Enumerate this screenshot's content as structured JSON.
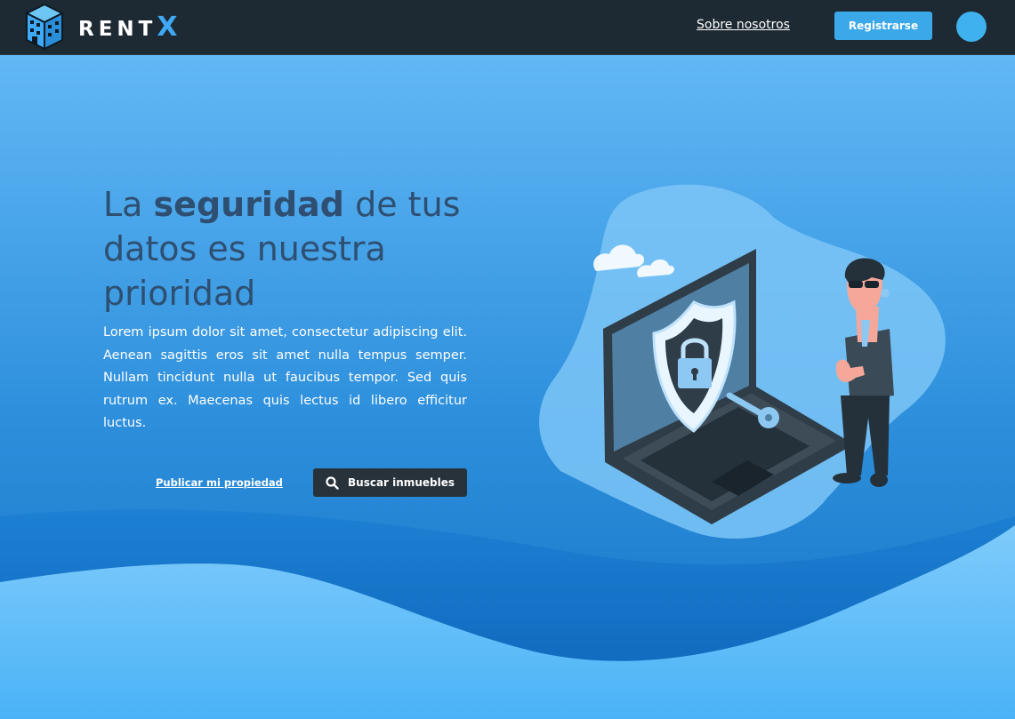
{
  "brand": {
    "name_main": "RENT",
    "name_accent": "X"
  },
  "nav": {
    "about_label": "Sobre nosotros",
    "register_label": "Registrarse"
  },
  "hero": {
    "headline_part1": "La ",
    "headline_bold": "seguridad",
    "headline_part2": " de tus datos es nuestra prioridad",
    "body": "Lorem ipsum dolor sit amet, consectetur adipiscing elit. Aenean sagittis eros sit amet nulla tempus semper. Nullam tincidunt nulla ut faucibus tempor. Sed quis rutrum ex. Maecenas quis lectus id libero efficitur luctus.",
    "publish_label": "Publicar mi propiedad",
    "search_label": "Buscar inmuebles"
  },
  "icons": {
    "logo": "building-logo-icon",
    "search": "search-icon",
    "avatar": "user-avatar"
  },
  "colors": {
    "navbar": "#1e2a33",
    "accent": "#3ba8ea",
    "headline": "#2e4f71",
    "search_button": "#27323b"
  }
}
